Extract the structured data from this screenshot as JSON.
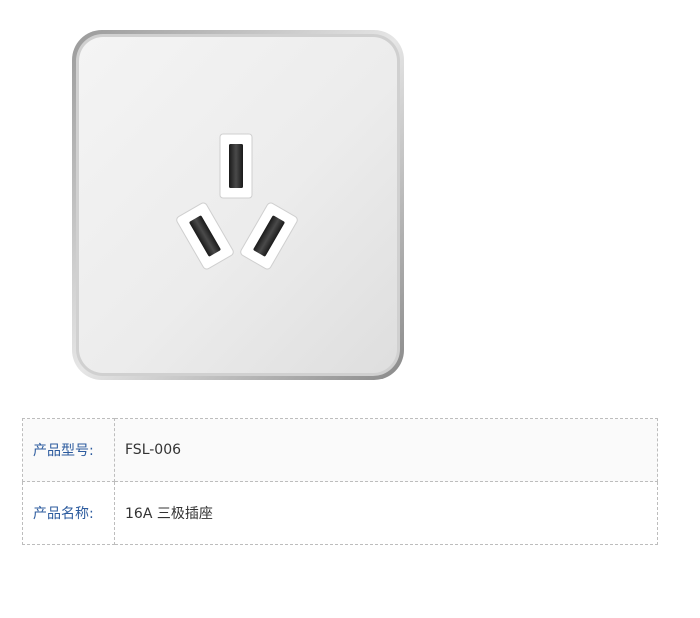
{
  "product_image": {
    "icon": "socket-outlet-icon"
  },
  "specs": {
    "rows": [
      {
        "label": "产品型号:",
        "value": "FSL-006"
      },
      {
        "label": "产品名称:",
        "value": "16A 三极插座"
      }
    ]
  },
  "colors": {
    "label_text": "#2c5b9e",
    "value_text": "#333333",
    "table_border": "#bdbdbd"
  }
}
